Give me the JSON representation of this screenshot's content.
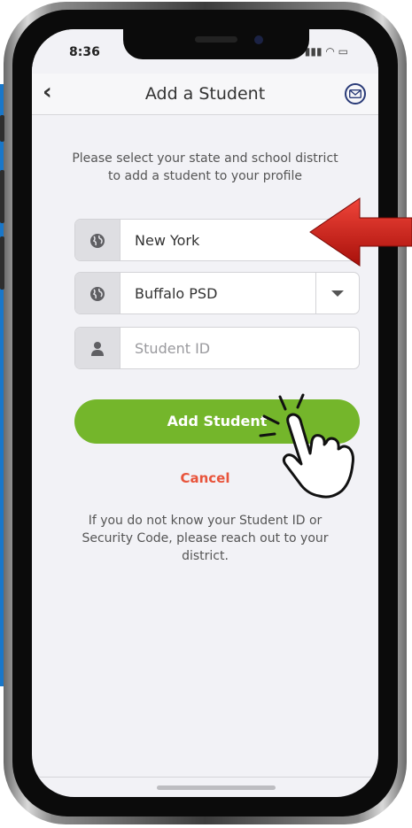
{
  "status": {
    "time": "8:36"
  },
  "header": {
    "back_icon": "chevron-left-icon",
    "title": "Add a Student",
    "mail_icon": "mail-icon"
  },
  "intro": {
    "text": "Please select your state and school district to add a student to your profile"
  },
  "form": {
    "state": {
      "value": "New York",
      "icon": "globe-icon"
    },
    "district": {
      "value": "Buffalo PSD",
      "icon": "globe-icon"
    },
    "student_id": {
      "placeholder": "Student ID",
      "icon": "person-icon"
    }
  },
  "actions": {
    "add_label": "Add Student",
    "cancel_label": "Cancel"
  },
  "help": {
    "text": "If you do not know your Student ID or Security Code, please reach out to your district."
  },
  "colors": {
    "accent_green": "#74b62b",
    "cancel_red": "#e8543b",
    "arrow_red": "#d01a12",
    "bg_blue": "#1977c9"
  }
}
